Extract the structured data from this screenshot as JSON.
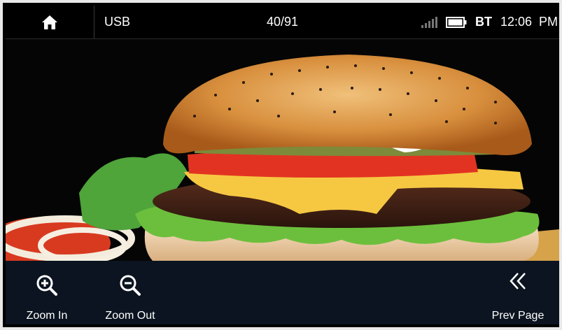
{
  "topbar": {
    "source": "USB",
    "counter": "40/91",
    "bt": "BT",
    "time": "12:06",
    "ampm": "PM"
  },
  "photo": {
    "subject": "cheeseburger"
  },
  "bottombar": {
    "zoom_in": "Zoom In",
    "zoom_out": "Zoom Out",
    "prev_page": "Prev Page"
  },
  "icons": [
    "home-icon",
    "signal-icon",
    "battery-icon",
    "zoom-in-icon",
    "zoom-out-icon",
    "prev-page-icon"
  ],
  "colors": {
    "bar_bg": "#000000",
    "bottom_bg": "#0b1420",
    "text": "#ffffff"
  }
}
